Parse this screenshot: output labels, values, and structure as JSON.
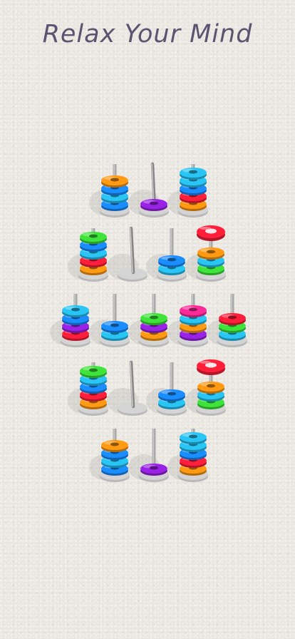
{
  "headline": "Relax Your Mind",
  "colors": {
    "orange": "#ff9a12",
    "blue": "#1a8dff",
    "cyan": "#28c5f5",
    "red": "#ff1f3a",
    "green": "#3ee43a",
    "purple": "#9a22e6",
    "pink": "#ff2a9a",
    "white": "#ffffff",
    "peg": "#a9a9a9",
    "base": "#d4d4d4"
  },
  "rows": [
    {
      "pegs": [
        {
          "rings": [
            "blue",
            "cyan",
            "blue",
            "orange"
          ]
        },
        {
          "rings": [
            "purple"
          ],
          "slanted": true
        },
        {
          "rings": [
            "orange",
            "red",
            "blue",
            "cyan",
            "cyan"
          ]
        }
      ]
    },
    {
      "pegs": [
        {
          "rings": [
            "orange",
            "red",
            "cyan",
            "blue",
            "green"
          ]
        },
        {
          "rings": [],
          "slanted": true
        },
        {
          "rings": [
            "cyan",
            "blue"
          ]
        },
        {
          "rings": [
            "green",
            "cyan",
            "orange"
          ],
          "floating": "red"
        }
      ]
    },
    {
      "pegs": [
        {
          "rings": [
            "red",
            "purple",
            "blue",
            "cyan"
          ]
        },
        {
          "rings": [
            "cyan",
            "blue"
          ]
        },
        {
          "rings": [
            "orange",
            "purple",
            "green"
          ]
        },
        {
          "rings": [
            "purple",
            "orange",
            "cyan",
            "pink"
          ]
        },
        {
          "rings": [
            "cyan",
            "green",
            "red"
          ]
        }
      ]
    },
    {
      "pegs": [
        {
          "rings": [
            "orange",
            "red",
            "blue",
            "cyan",
            "green"
          ]
        },
        {
          "rings": [],
          "slanted": true
        },
        {
          "rings": [
            "cyan",
            "blue"
          ]
        },
        {
          "rings": [
            "green",
            "cyan",
            "orange"
          ],
          "floating": "red"
        }
      ]
    },
    {
      "pegs": [
        {
          "rings": [
            "blue",
            "cyan",
            "blue",
            "orange"
          ]
        },
        {
          "rings": [
            "purple"
          ]
        },
        {
          "rings": [
            "orange",
            "red",
            "blue",
            "cyan",
            "cyan"
          ]
        }
      ]
    }
  ]
}
